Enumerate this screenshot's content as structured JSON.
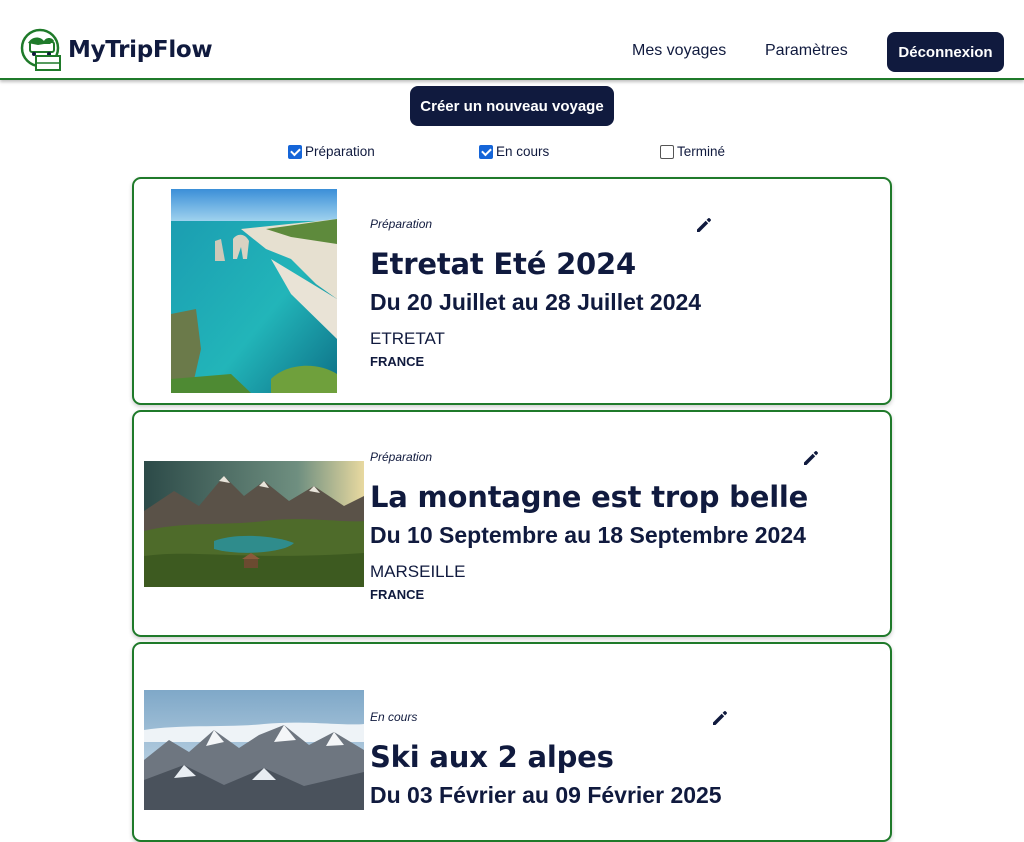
{
  "app": {
    "name": "MyTripFlow"
  },
  "nav": {
    "links": [
      {
        "label": "Mes voyages"
      },
      {
        "label": "Paramètres"
      }
    ],
    "logout_label": "Déconnexion"
  },
  "actions": {
    "create_label": "Créer un nouveau voyage"
  },
  "filters": [
    {
      "label": "Préparation",
      "checked": true
    },
    {
      "label": "En cours",
      "checked": true
    },
    {
      "label": "Terminé",
      "checked": false
    }
  ],
  "trips": [
    {
      "status": "Préparation",
      "title": "Etretat Eté 2024",
      "dates": "Du 20 Juillet au 28 Juillet 2024",
      "city": "ETRETAT",
      "country": "FRANCE",
      "image": "cliffs-sea"
    },
    {
      "status": "Préparation",
      "title": "La montagne est trop belle",
      "dates": "Du 10 Septembre au 18 Septembre 2024",
      "city": "MARSEILLE",
      "country": "FRANCE",
      "image": "mountain-lake"
    },
    {
      "status": "En cours",
      "title": "Ski aux 2 alpes",
      "dates": "Du 03 Février au 09 Février 2025",
      "city": "",
      "country": "",
      "image": "snowy-peaks"
    }
  ],
  "colors": {
    "primary": "#101a3e",
    "accent": "#1f7a2a",
    "checkbox": "#1565d8"
  }
}
